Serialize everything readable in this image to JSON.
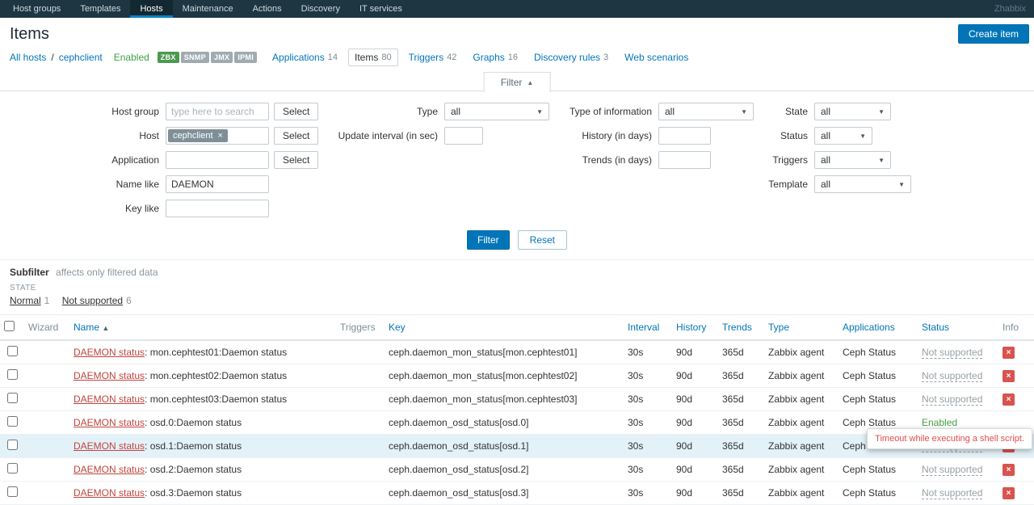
{
  "icons": {
    "sort_asc": "▲",
    "caret_down": "▼",
    "collapse": "▲",
    "remove": "×",
    "error": "×"
  },
  "nav": {
    "items": [
      {
        "label": "Host groups"
      },
      {
        "label": "Templates"
      },
      {
        "label": "Hosts"
      },
      {
        "label": "Maintenance"
      },
      {
        "label": "Actions"
      },
      {
        "label": "Discovery"
      },
      {
        "label": "IT services"
      }
    ],
    "brand": "Zhabbix"
  },
  "header": {
    "title": "Items",
    "create_button": "Create item"
  },
  "breadcrumb": {
    "all_hosts": "All hosts",
    "separator": "/",
    "host": "cephclient",
    "enabled": "Enabled",
    "badges": [
      {
        "label": "ZBX"
      },
      {
        "label": "SNMP"
      },
      {
        "label": "JMX"
      },
      {
        "label": "IPMI"
      }
    ],
    "tabs": [
      {
        "label": "Applications",
        "count": "14"
      },
      {
        "label": "Items",
        "count": "80"
      },
      {
        "label": "Triggers",
        "count": "42"
      },
      {
        "label": "Graphs",
        "count": "16"
      },
      {
        "label": "Discovery rules",
        "count": "3"
      },
      {
        "label": "Web scenarios",
        "count": ""
      }
    ]
  },
  "filter": {
    "tab": "Filter",
    "host_group_label": "Host group",
    "host_group_placeholder": "type here to search",
    "host_label": "Host",
    "host_chip": "cephclient",
    "application_label": "Application",
    "name_like_label": "Name like",
    "name_like_value": "DAEMON",
    "key_like_label": "Key like",
    "key_like_value": "",
    "select_button": "Select",
    "type_label": "Type",
    "type_value": "all",
    "update_interval_label": "Update interval (in sec)",
    "update_interval_value": "",
    "type_of_information_label": "Type of information",
    "type_of_information_value": "all",
    "history_label": "History (in days)",
    "history_value": "",
    "trends_label": "Trends (in days)",
    "trends_value": "",
    "state_label": "State",
    "state_value": "all",
    "status_label": "Status",
    "status_value": "all",
    "triggers_label": "Triggers",
    "triggers_value": "all",
    "template_label": "Template",
    "template_value": "all",
    "filter_button": "Filter",
    "reset_button": "Reset"
  },
  "subfilter": {
    "title": "Subfilter",
    "subtitle": "affects only filtered data",
    "group": "STATE",
    "options": [
      {
        "label": "Normal",
        "count": "1"
      },
      {
        "label": "Not supported",
        "count": "6"
      }
    ]
  },
  "table": {
    "columns": {
      "wizard": "Wizard",
      "name": "Name",
      "triggers": "Triggers",
      "key": "Key",
      "interval": "Interval",
      "history": "History",
      "trends": "Trends",
      "type": "Type",
      "applications": "Applications",
      "status": "Status",
      "info": "Info"
    },
    "rows": [
      {
        "name_link": "DAEMON status",
        "name_text": ": mon.cephtest01:Daemon status",
        "key": "ceph.daemon_mon_status[mon.cephtest01]",
        "interval": "30s",
        "history": "90d",
        "trends": "365d",
        "type": "Zabbix agent",
        "applications": "Ceph Status",
        "status": "Not supported",
        "info": "×"
      },
      {
        "name_link": "DAEMON status",
        "name_text": ": mon.cephtest02:Daemon status",
        "key": "ceph.daemon_mon_status[mon.cephtest02]",
        "interval": "30s",
        "history": "90d",
        "trends": "365d",
        "type": "Zabbix agent",
        "applications": "Ceph Status",
        "status": "Not supported",
        "info": "×"
      },
      {
        "name_link": "DAEMON status",
        "name_text": ": mon.cephtest03:Daemon status",
        "key": "ceph.daemon_mon_status[mon.cephtest03]",
        "interval": "30s",
        "history": "90d",
        "trends": "365d",
        "type": "Zabbix agent",
        "applications": "Ceph Status",
        "status": "Not supported",
        "info": "×"
      },
      {
        "name_link": "DAEMON status",
        "name_text": ": osd.0:Daemon status",
        "key": "ceph.daemon_osd_status[osd.0]",
        "interval": "30s",
        "history": "90d",
        "trends": "365d",
        "type": "Zabbix agent",
        "applications": "Ceph Status",
        "status": "Enabled",
        "info": ""
      },
      {
        "name_link": "DAEMON status",
        "name_text": ": osd.1:Daemon status",
        "key": "ceph.daemon_osd_status[osd.1]",
        "interval": "30s",
        "history": "90d",
        "trends": "365d",
        "type": "Zabbix agent",
        "applications": "Ceph Status",
        "status": "Not supported",
        "info": "×"
      },
      {
        "name_link": "DAEMON status",
        "name_text": ": osd.2:Daemon status",
        "key": "ceph.daemon_osd_status[osd.2]",
        "interval": "30s",
        "history": "90d",
        "trends": "365d",
        "type": "Zabbix agent",
        "applications": "Ceph Status",
        "status": "Not supported",
        "info": "×"
      },
      {
        "name_link": "DAEMON status",
        "name_text": ": osd.3:Daemon status",
        "key": "ceph.daemon_osd_status[osd.3]",
        "interval": "30s",
        "history": "90d",
        "trends": "365d",
        "type": "Zabbix agent",
        "applications": "Ceph Status",
        "status": "Not supported",
        "info": "×"
      }
    ]
  },
  "tooltip": {
    "text": "Timeout while executing a shell script."
  }
}
